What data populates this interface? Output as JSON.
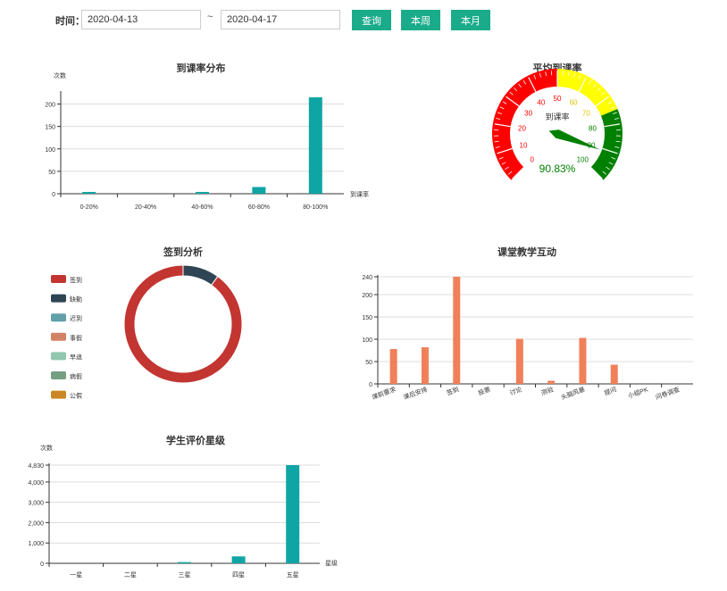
{
  "filter": {
    "label": "时间：",
    "start_date": "2020-04-13",
    "separator": "~",
    "end_date": "2020-04-17",
    "query_label": "查询",
    "week_label": "本周",
    "month_label": "本月",
    "button_color": "#1aab8a"
  },
  "chart_data": [
    {
      "id": "attendance_distribution",
      "type": "bar",
      "title": "到课率分布",
      "ylabel": "次数",
      "xlabel": "到课率",
      "categories": [
        "0-20%",
        "20-40%",
        "40-60%",
        "60-80%",
        "80-100%"
      ],
      "values": [
        4,
        0,
        4,
        15,
        215
      ],
      "ylim": [
        0,
        225
      ],
      "yticks": [
        0,
        50,
        100,
        150,
        200
      ],
      "color": "#0fa5a5",
      "grid": true
    },
    {
      "id": "average_attendance",
      "type": "gauge",
      "title": "平均到课率",
      "label": "到课率",
      "value": 90.83,
      "value_text": "90.83%",
      "min": 0,
      "max": 100,
      "ticks": [
        0,
        10,
        20,
        30,
        40,
        50,
        60,
        70,
        80,
        90,
        100
      ],
      "bands": [
        {
          "to": 50,
          "color": "#ff0000"
        },
        {
          "to": 75,
          "color": "#ffff00"
        },
        {
          "to": 100,
          "color": "#008000"
        }
      ]
    },
    {
      "id": "sign_in_analysis",
      "type": "pie",
      "title": "签到分析",
      "legend_position": "left",
      "series": [
        {
          "name": "签到",
          "value": 90,
          "color": "#c23531"
        },
        {
          "name": "缺勤",
          "value": 10,
          "color": "#2f4554"
        },
        {
          "name": "迟到",
          "value": 0,
          "color": "#61a0a8"
        },
        {
          "name": "事假",
          "value": 0,
          "color": "#d48265"
        },
        {
          "name": "早退",
          "value": 0,
          "color": "#91c7ae"
        },
        {
          "name": "病假",
          "value": 0,
          "color": "#749f83"
        },
        {
          "name": "公假",
          "value": 0,
          "color": "#ca8622"
        }
      ]
    },
    {
      "id": "classroom_interaction",
      "type": "bar",
      "title": "课堂教学互动",
      "categories": [
        "课前要求",
        "课后安排",
        "签到",
        "投票",
        "讨论",
        "测验",
        "头脑风暴",
        "提问",
        "小组PK",
        "问卷调查"
      ],
      "values": [
        78,
        82,
        240,
        0,
        101,
        7,
        103,
        43,
        0,
        0
      ],
      "ylim": [
        0,
        240
      ],
      "yticks": [
        0,
        50,
        100,
        150,
        200,
        240
      ],
      "color": "#f0805a",
      "grid": true
    },
    {
      "id": "student_rating",
      "type": "bar",
      "title": "学生评价星级",
      "ylabel": "次数",
      "xlabel": "星级",
      "categories": [
        "一星",
        "二星",
        "三星",
        "四星",
        "五星"
      ],
      "values": [
        0,
        0,
        60,
        340,
        4830
      ],
      "ylim": [
        0,
        4830
      ],
      "yticks": [
        0,
        1000,
        2000,
        3000,
        4000,
        4830
      ],
      "ytick_labels": [
        "0",
        "1,000",
        "2,000",
        "3,000",
        "4,000",
        "4,830"
      ],
      "color": "#0fa5a5",
      "grid": true
    }
  ]
}
